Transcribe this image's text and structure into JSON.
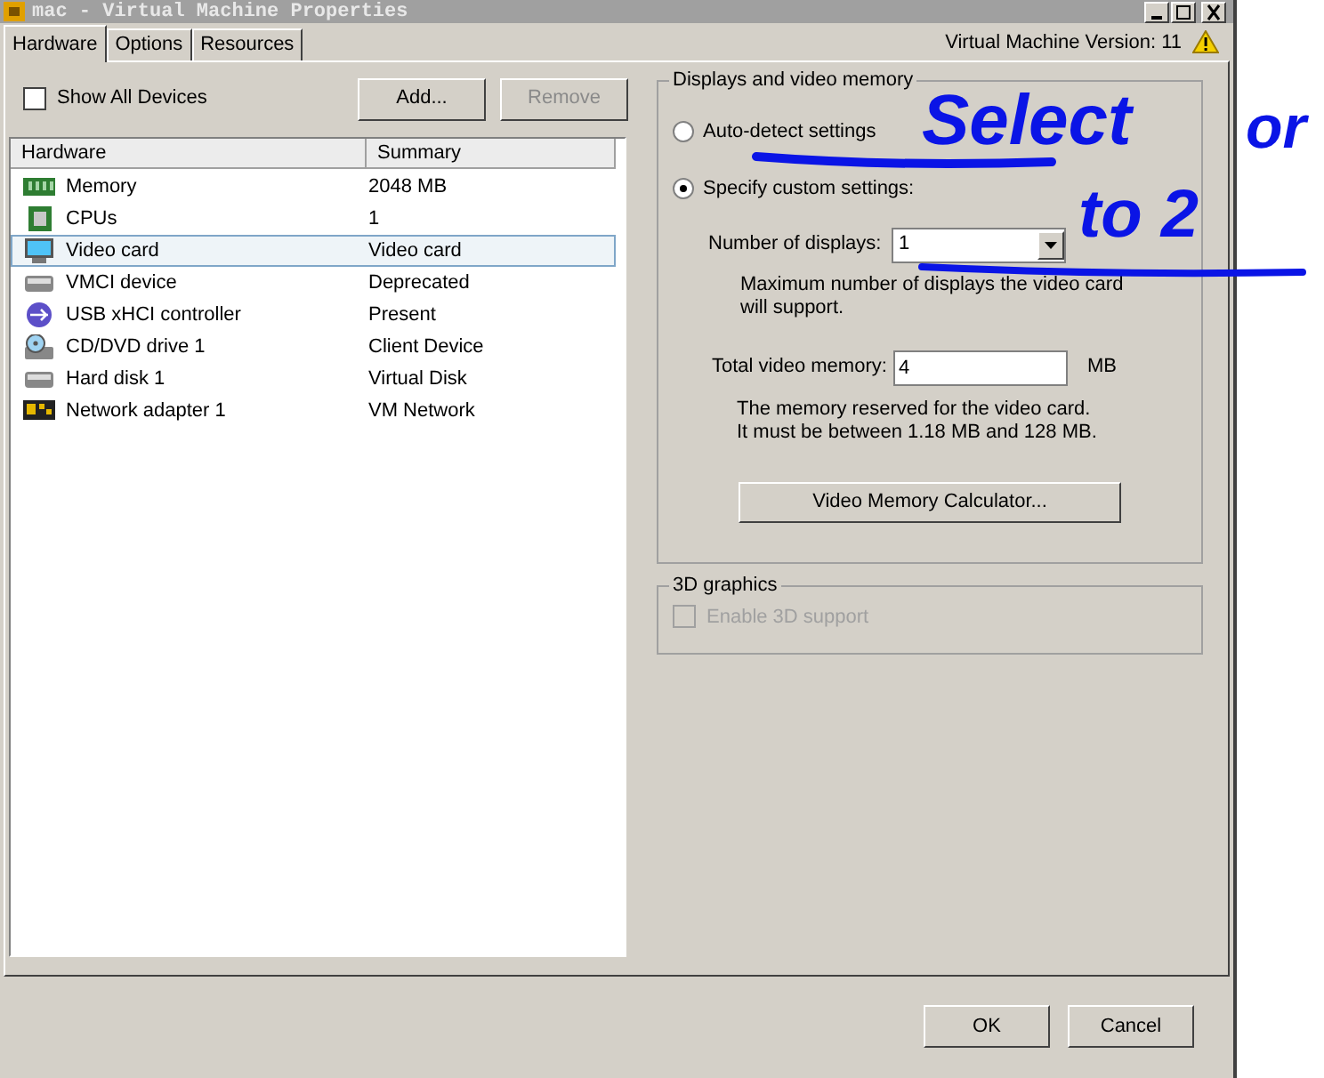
{
  "window": {
    "title": "mac - Virtual Machine Properties"
  },
  "tabs": [
    {
      "label": "Hardware",
      "selected": true
    },
    {
      "label": "Options",
      "selected": false
    },
    {
      "label": "Resources",
      "selected": false
    }
  ],
  "version_label": "Virtual Machine Version: 11",
  "show_all_devices": {
    "label": "Show All Devices",
    "checked": false
  },
  "device_buttons": [
    {
      "label": "Add...",
      "disabled": false
    },
    {
      "label": "Remove",
      "disabled": true
    }
  ],
  "hardware_table": {
    "columns": [
      "Hardware",
      "Summary"
    ],
    "rows": [
      {
        "kind": "memory",
        "name": "Memory",
        "summary": "2048 MB",
        "selected": false
      },
      {
        "kind": "cpu",
        "name": "CPUs",
        "summary": "1",
        "selected": false
      },
      {
        "kind": "display",
        "name": "Video card",
        "summary": "Video card",
        "selected": true
      },
      {
        "kind": "device",
        "name": "VMCI device",
        "summary": "Deprecated",
        "selected": false
      },
      {
        "kind": "usb",
        "name": "USB xHCI controller",
        "summary": "Present",
        "selected": false
      },
      {
        "kind": "cd",
        "name": "CD/DVD drive 1",
        "summary": "Client Device",
        "selected": false
      },
      {
        "kind": "device",
        "name": "Hard disk 1",
        "summary": "Virtual Disk",
        "selected": false
      },
      {
        "kind": "network",
        "name": "Network adapter 1",
        "summary": "VM Network",
        "selected": false
      }
    ]
  },
  "displays_group": {
    "title": "Displays and video memory",
    "options": [
      {
        "label": "Auto-detect settings",
        "selected": false
      },
      {
        "label": "Specify custom settings:",
        "selected": true
      }
    ],
    "number_of_displays": {
      "label": "Number of displays:",
      "value": "1",
      "hint_lines": [
        "Maximum number of displays the video card",
        "will support."
      ]
    },
    "total_video_memory": {
      "label": "Total video memory:",
      "value": "4",
      "unit": "MB",
      "hint_lines": [
        "The memory reserved for the video card.",
        "It must be between 1.18 MB and 128 MB."
      ]
    },
    "calculator_button": "Video Memory Calculator..."
  },
  "graphics_3d": {
    "title": "3D graphics",
    "enable": {
      "label": "Enable 3D support",
      "checked": false,
      "disabled": true
    }
  },
  "dialog_buttons": [
    "OK",
    "Cancel"
  ],
  "annotations": [
    "Select",
    "or",
    "to 2"
  ]
}
